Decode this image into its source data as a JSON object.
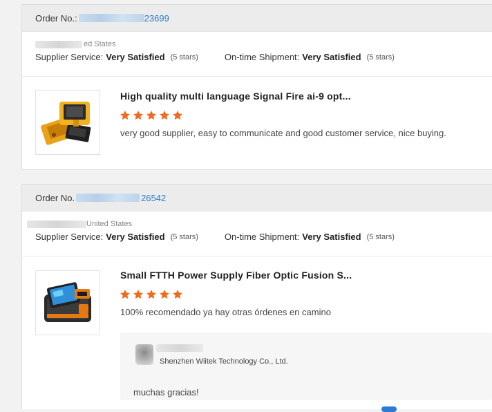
{
  "orders": [
    {
      "order_label": "Order No.:",
      "order_suffix": "23699",
      "country": "ed States",
      "supplier_label": "Supplier Service:",
      "supplier_value": "Very Satisfied",
      "supplier_stars": "(5 stars)",
      "shipment_label": "On-time Shipment:",
      "shipment_value": "Very Satisfied",
      "shipment_stars": "(5 stars)",
      "product_title": "High quality multi language Signal Fire ai-9 opt...",
      "rating": 5,
      "comment": "very good supplier, easy to communicate and good customer service, nice buying.",
      "product_icon": "fusion-splicer-yellow-icon"
    },
    {
      "order_label": "Order No.",
      "order_suffix": "26542",
      "country": "United States",
      "supplier_label": "Supplier Service:",
      "supplier_value": "Very Satisfied",
      "supplier_stars": "(5 stars)",
      "shipment_label": "On-time Shipment:",
      "shipment_value": "Very Satisfied",
      "shipment_stars": "(5 stars)",
      "product_title": "Small FTTH Power Supply Fiber Optic Fusion S...",
      "rating": 5,
      "comment": "100% recomendado ya hay otras órdenes en camino",
      "product_icon": "fusion-splicer-orange-icon",
      "reply": {
        "name": "Shenzhen Wiitek Technology Co., Ltd.",
        "text": "muchas gracias!"
      }
    }
  ],
  "colors": {
    "star": "#f26b1d",
    "link": "#2d7bd4",
    "header_bg": "#ececec"
  }
}
